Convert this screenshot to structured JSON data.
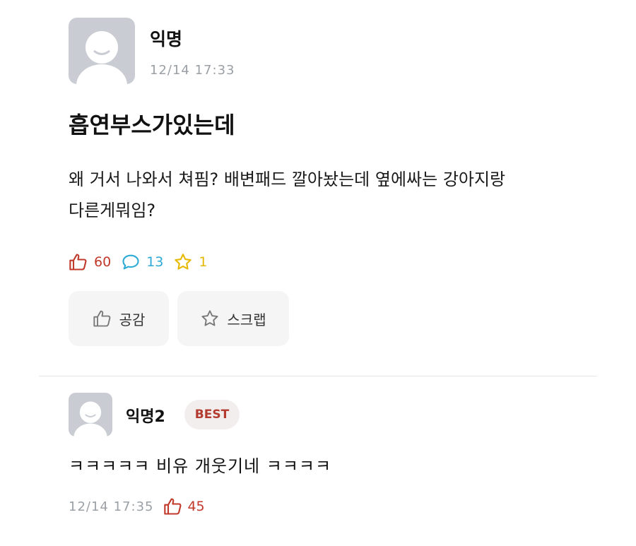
{
  "post": {
    "author": "익명",
    "time": "12/14 17:33",
    "title": "흡연부스가있는데",
    "body_lines": [
      "왜 거서 나와서 쳐핌? 배변패드 깔아놨는데 옆에싸는 강아지랑",
      "다른게뭐임?"
    ],
    "stats": {
      "likes": "60",
      "comments": "13",
      "scraps": "1"
    },
    "buttons": {
      "like_label": "공감",
      "scrap_label": "스크랩"
    }
  },
  "comment": {
    "author": "익명2",
    "badge": "BEST",
    "text": "ㅋㅋㅋㅋㅋ 비유 개웃기네 ㅋㅋㅋㅋ",
    "time": "12/14 17:35",
    "likes": "45"
  },
  "colors": {
    "like": "#c0392b",
    "comment": "#2eaad6",
    "scrap": "#e6b800",
    "avatar_bg": "#c9cdd3",
    "button_bg": "#f5f5f6"
  },
  "icons": [
    "default-avatar-icon",
    "thumbs-up-icon",
    "speech-bubble-icon",
    "star-icon"
  ]
}
